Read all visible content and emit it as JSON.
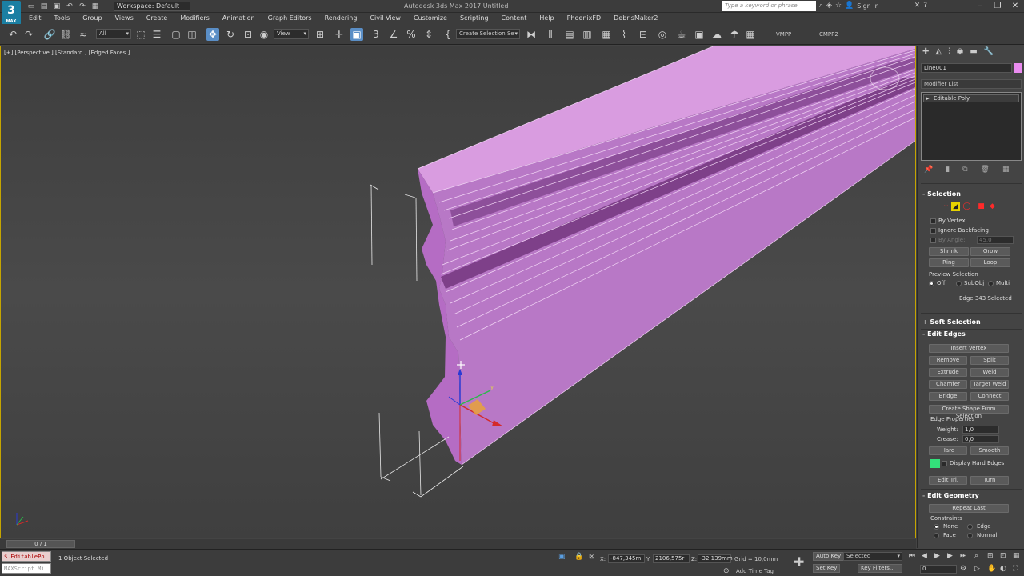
{
  "titlebar": {
    "workspace": "Workspace: Default",
    "window_title": "Autodesk 3ds Max 2017    Untitled",
    "search_placeholder": "Type a keyword or phrase",
    "sign_in": "Sign In",
    "logo": "3",
    "logo_sub": "MAX"
  },
  "menu": [
    "Edit",
    "Tools",
    "Group",
    "Views",
    "Create",
    "Modifiers",
    "Animation",
    "Graph Editors",
    "Rendering",
    "Civil View",
    "Customize",
    "Scripting",
    "Content",
    "Help",
    "PhoenixFD",
    "DebrisMaker2"
  ],
  "toolbar": {
    "filter_dropdown": "All",
    "ref_coord_dropdown": "View",
    "named_selection": "Create Selection Se",
    "vmpp": "VMPP",
    "cmpp2": "CMPP2"
  },
  "viewport": {
    "label": "[+] [Perspective ] [Standard ] [Edged Faces ]",
    "object_color": "#c878d2",
    "background_top": "#3e3e3e"
  },
  "command_panel": {
    "object_name": "Line001",
    "object_color": "#ea8cf0",
    "modifier_list": "Modifier List",
    "stack_item": "Editable Poly",
    "selection": {
      "title": "Selection",
      "by_vertex": "By Vertex",
      "ignore_backfacing": "Ignore Backfacing",
      "by_angle": "By Angle:",
      "angle_value": "45,0",
      "shrink": "Shrink",
      "grow": "Grow",
      "ring": "Ring",
      "loop": "Loop",
      "preview_selection": "Preview Selection",
      "preview_off": "Off",
      "preview_subobj": "SubObj",
      "preview_multi": "Multi",
      "status": "Edge 343 Selected"
    },
    "soft_selection": {
      "title": "Soft Selection"
    },
    "edit_edges": {
      "title": "Edit Edges",
      "insert_vertex": "Insert Vertex",
      "remove": "Remove",
      "split": "Split",
      "extrude": "Extrude",
      "weld": "Weld",
      "chamfer": "Chamfer",
      "target_weld": "Target Weld",
      "bridge": "Bridge",
      "connect": "Connect",
      "create_shape": "Create Shape From Selection",
      "edge_properties": "Edge Properties",
      "weight_label": "Weight:",
      "weight_value": "1,0",
      "crease_label": "Crease:",
      "crease_value": "0,0",
      "hard": "Hard",
      "smooth": "Smooth",
      "display_hard_edges": "Display Hard Edges",
      "hard_edge_color": "#33e07a",
      "edit_tri": "Edit Tri.",
      "turn": "Turn"
    },
    "edit_geometry": {
      "title": "Edit Geometry",
      "repeat_last": "Repeat Last",
      "constraints": "Constraints",
      "none": "None",
      "edge": "Edge",
      "face": "Face",
      "normal": "Normal"
    }
  },
  "timeline": {
    "slider": "0 / 1"
  },
  "status": {
    "script_line1": "$.EditablePo",
    "script_line2": "MAXScript Mi",
    "selection_text": "1 Object Selected",
    "x_value": "-847,345m",
    "y_value": "2106,575r",
    "z_value": "-32,139mm",
    "grid": "Grid = 10,0mm",
    "add_time_tag": "Add Time Tag",
    "auto_key": "Auto Key",
    "set_key": "Set Key",
    "selected_dropdown": "Selected",
    "key_filters": "Key Filters...",
    "frame_value": "0",
    "x_label": "X:",
    "y_label": "Y:",
    "z_label": "Z:"
  }
}
